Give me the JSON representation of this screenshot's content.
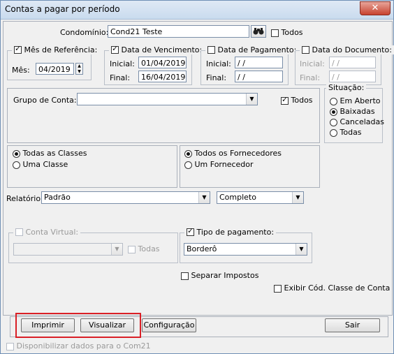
{
  "window": {
    "title": "Contas a pagar por período",
    "close": "✕"
  },
  "condominio": {
    "label": "Condomínio:",
    "value": "Cond21 Teste",
    "todos_label": "Todos",
    "todos_checked": false
  },
  "mes_ref": {
    "title": "Mês de Referência:",
    "checked": true,
    "mes_label": "Mês:",
    "mes_value": "04/2019"
  },
  "data_venc": {
    "title": "Data de Vencimento:",
    "checked": true,
    "inicial_label": "Inicial:",
    "inicial_value": "01/04/2019",
    "final_label": "Final:",
    "final_value": "16/04/2019"
  },
  "data_pag": {
    "title": "Data de Pagamento:",
    "checked": false,
    "inicial_label": "Inicial:",
    "inicial_value": " / /",
    "final_label": "Final:",
    "final_value": " / /"
  },
  "data_doc": {
    "title": "Data do Documento:",
    "checked": false,
    "inicial_label": "Inicial:",
    "inicial_value": " / /",
    "final_label": "Final:",
    "final_value": " / /"
  },
  "grupo_conta": {
    "label": "Grupo de Conta:",
    "value": "",
    "todos_label": "Todos",
    "todos_checked": true
  },
  "situacao": {
    "title": "Situação:",
    "options": [
      "Em Aberto",
      "Baixadas",
      "Canceladas",
      "Todas"
    ],
    "selected": "Baixadas"
  },
  "classes": {
    "options": [
      "Todas as Classes",
      "Uma Classe"
    ],
    "selected": "Todas as Classes"
  },
  "fornecedores": {
    "options": [
      "Todos os Fornecedores",
      "Um Fornecedor"
    ],
    "selected": "Todos os Fornecedores"
  },
  "relatorio": {
    "label": "Relatório:",
    "value": "Padrão",
    "tipo_value": "Completo"
  },
  "conta_virtual": {
    "title": "Conta Virtual:",
    "checked": false,
    "value": "",
    "todas_label": "Todas",
    "todas_checked": false
  },
  "tipo_pagamento": {
    "title": "Tipo de pagamento:",
    "checked": true,
    "value": "Borderô"
  },
  "separar_impostos": {
    "label": "Separar Impostos",
    "checked": false
  },
  "exibir_cod": {
    "label": "Exibir Cód. Classe de Conta",
    "checked": false
  },
  "buttons": {
    "imprimir": "Imprimir",
    "visualizar": "Visualizar",
    "configuracao": "Configuração",
    "sair": "Sair"
  },
  "disponibilizar": {
    "label": "Disponibilizar dados para o Com21",
    "checked": false
  },
  "colors": {
    "highlight": "#d91f26",
    "titlebar": "#c9dbee"
  }
}
